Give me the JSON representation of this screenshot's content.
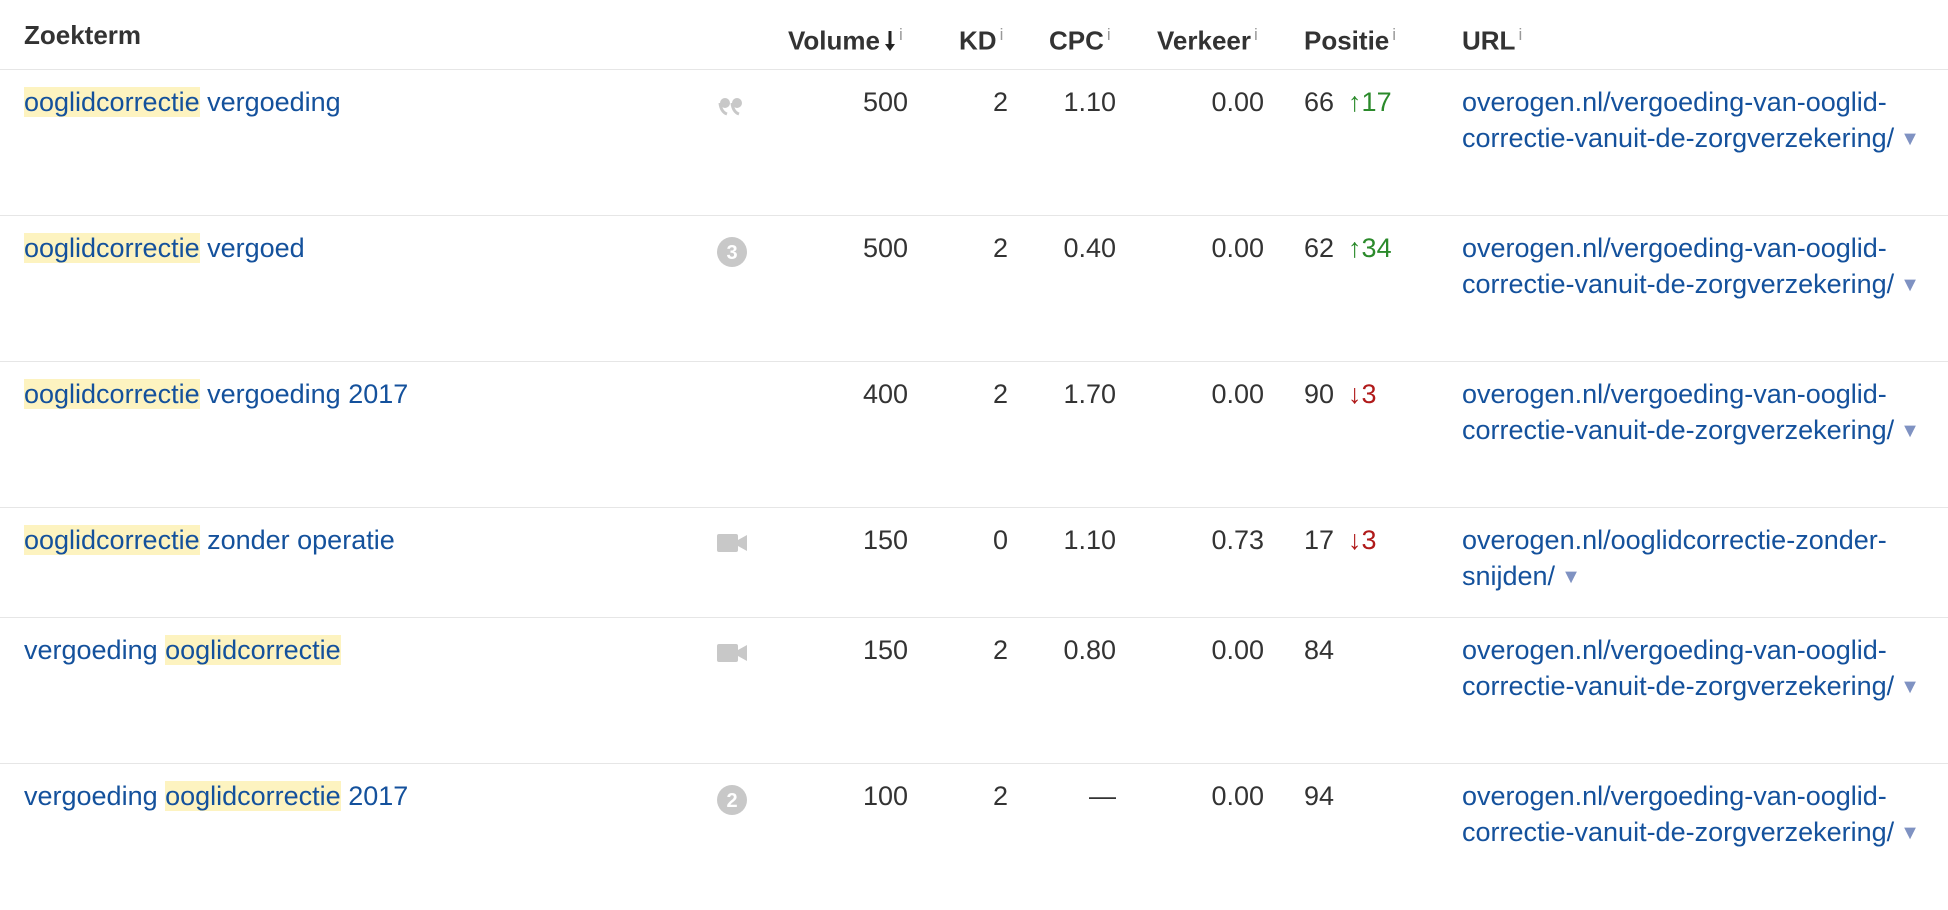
{
  "columns": {
    "keyword": "Zoekterm",
    "volume": "Volume",
    "kd": "KD",
    "cpc": "CPC",
    "traffic": "Verkeer",
    "position": "Positie",
    "url": "URL",
    "info": "i"
  },
  "rows": [
    {
      "kw_pre": "",
      "kw_hl": "ooglidcorrectie",
      "kw_post": " vergoeding",
      "feature_icon": "quote-icon",
      "volume": "500",
      "kd": "2",
      "cpc": "1.10",
      "traffic": "0.00",
      "position": "66",
      "change": "17",
      "change_dir": "up",
      "url": "overogen.nl/vergoeding-van-ooglid-correctie-vanuit-de-zorgverzekering/"
    },
    {
      "kw_pre": "",
      "kw_hl": "ooglidcorrectie",
      "kw_post": " vergoed",
      "feature_icon": "badge-icon",
      "feature_badge": "3",
      "volume": "500",
      "kd": "2",
      "cpc": "0.40",
      "traffic": "0.00",
      "position": "62",
      "change": "34",
      "change_dir": "up",
      "url": "overogen.nl/vergoeding-van-ooglid-correctie-vanuit-de-zorgverzekering/"
    },
    {
      "kw_pre": "",
      "kw_hl": "ooglidcorrectie",
      "kw_post": " vergoeding 2017",
      "feature_icon": "",
      "volume": "400",
      "kd": "2",
      "cpc": "1.70",
      "traffic": "0.00",
      "position": "90",
      "change": "3",
      "change_dir": "down",
      "url": "overogen.nl/vergoeding-van-ooglid-correctie-vanuit-de-zorgverzekering/"
    },
    {
      "kw_pre": "",
      "kw_hl": "ooglidcorrectie",
      "kw_post": " zonder operatie",
      "feature_icon": "video-icon",
      "volume": "150",
      "kd": "0",
      "cpc": "1.10",
      "traffic": "0.73",
      "position": "17",
      "change": "3",
      "change_dir": "down",
      "url": "overogen.nl/ooglidcorrectie-zonder-snijden/"
    },
    {
      "kw_pre": "vergoeding ",
      "kw_hl": "ooglidcorrectie",
      "kw_post": "",
      "feature_icon": "video-icon",
      "volume": "150",
      "kd": "2",
      "cpc": "0.80",
      "traffic": "0.00",
      "position": "84",
      "change": "",
      "change_dir": "",
      "url": "overogen.nl/vergoeding-van-ooglid-correctie-vanuit-de-zorgverzekering/"
    },
    {
      "kw_pre": "vergoeding ",
      "kw_hl": "ooglidcorrectie",
      "kw_post": " 2017",
      "feature_icon": "badge-icon",
      "feature_badge": "2",
      "volume": "100",
      "kd": "2",
      "cpc": "—",
      "traffic": "0.00",
      "position": "94",
      "change": "",
      "change_dir": "",
      "url": "overogen.nl/vergoeding-van-ooglid-correctie-vanuit-de-zorgverzekering/"
    }
  ],
  "colors": {
    "link": "#14519c",
    "highlight": "#fdf3c0",
    "up": "#2b8a2b",
    "down": "#b01a1a",
    "icon": "#c8c8c8"
  }
}
